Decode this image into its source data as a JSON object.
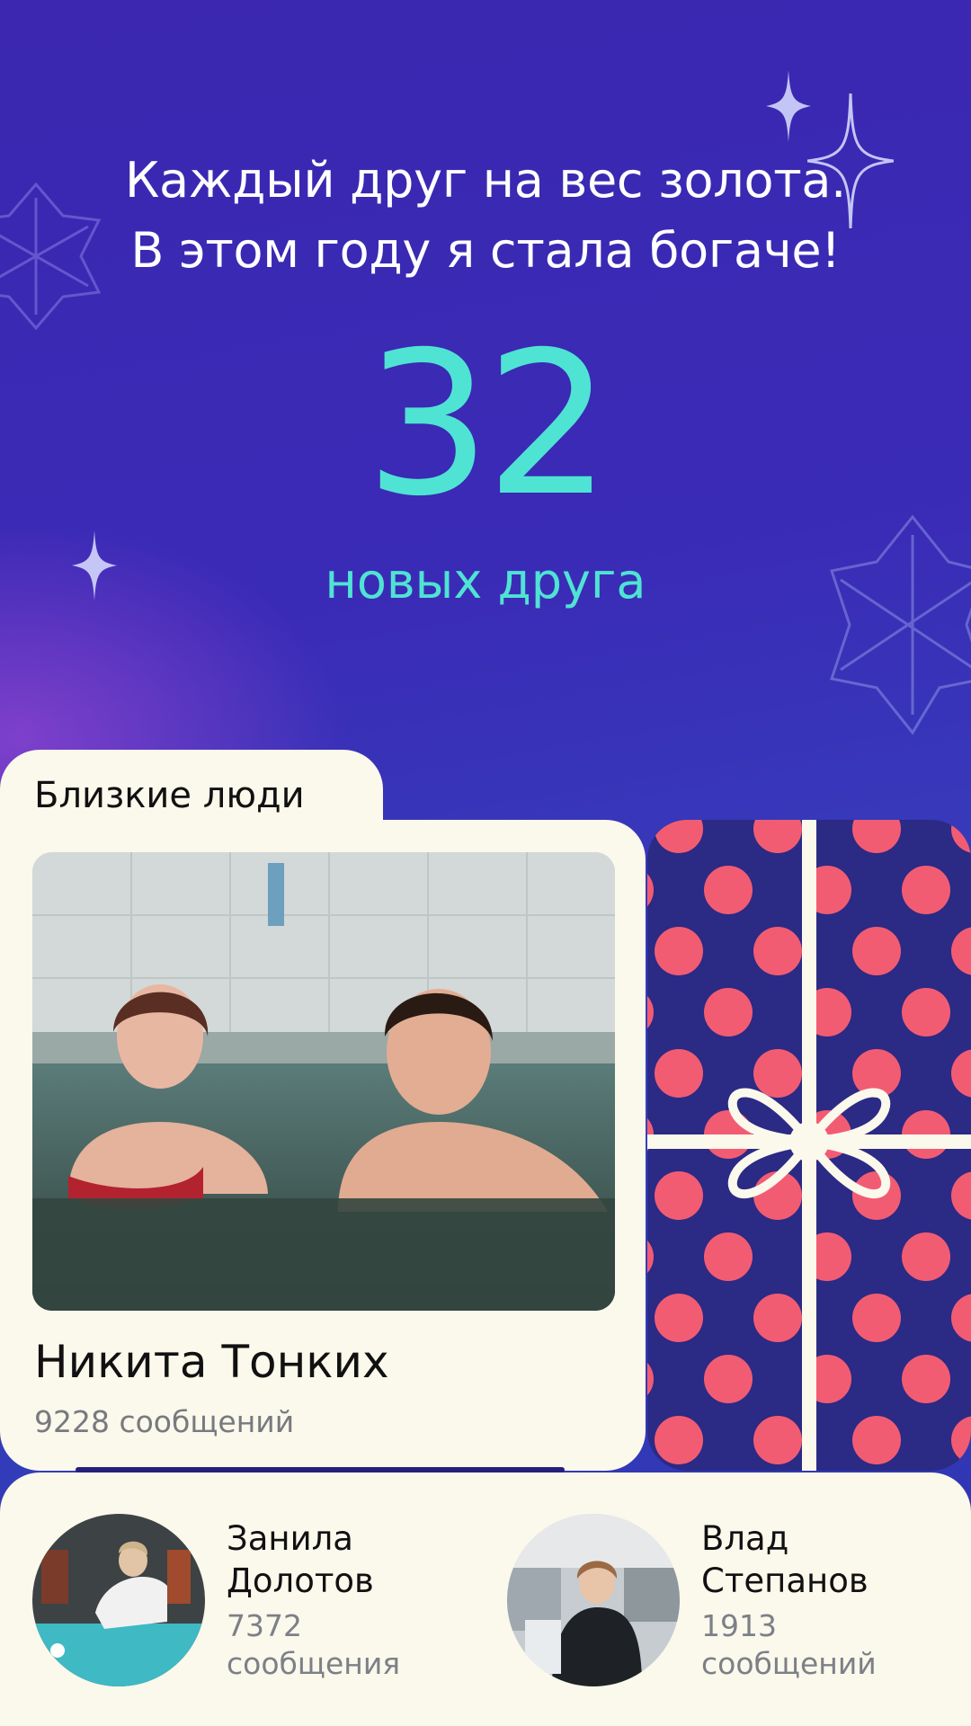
{
  "headline": {
    "line1": "Каждый друг на вес золота.",
    "line2": "В этом году я стала богаче!"
  },
  "stat": {
    "value": "32",
    "label": "новых друга"
  },
  "close_people": {
    "title": "Близкие люди",
    "top": {
      "name": "Никита Тонких",
      "messages": "9228 сообщений"
    },
    "others": [
      {
        "first": "Занила",
        "last": "Долотов",
        "count": "7372",
        "unit": "сообщения"
      },
      {
        "first": "Влад",
        "last": "Степанов",
        "count": "1913",
        "unit": "сообщений"
      }
    ]
  },
  "colors": {
    "accent": "#4fe3d3",
    "card": "#fbf8ec",
    "gift_dots": "#f25c72",
    "gift_bg": "#2b2a85"
  },
  "icons": [
    "sparkle-icon",
    "snowflake-icon",
    "gift-icon"
  ]
}
